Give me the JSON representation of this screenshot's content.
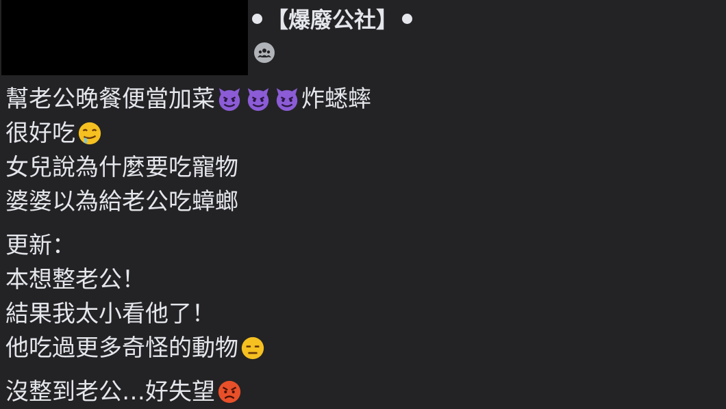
{
  "header": {
    "group_name": "【爆廢公社】",
    "audience_icon": "group-icon"
  },
  "post": {
    "paragraph1": [
      {
        "text": "幫老公晚餐便當加菜",
        "emojis": [
          "smiling-devil",
          "smiling-devil",
          "smiling-devil"
        ],
        "text_after": "炸蟋蟀"
      },
      {
        "text": "很好吃",
        "emojis": [
          "drooling-face"
        ]
      },
      {
        "text": "女兒說為什麼要吃寵物"
      },
      {
        "text": "婆婆以為給老公吃蟑螂"
      }
    ],
    "paragraph2": [
      {
        "text": "更新："
      },
      {
        "text": "本想整老公！"
      },
      {
        "text": "結果我太小看他了！"
      },
      {
        "text": "他吃過更多奇怪的動物",
        "emojis": [
          "expressionless-face"
        ]
      }
    ],
    "paragraph3": [
      {
        "text": "沒整到老公…好失望",
        "emojis": [
          "angry-face"
        ]
      }
    ]
  },
  "colors": {
    "background": "#232325",
    "text": "#e4e6eb",
    "devil_purple": "#8b5cd6",
    "emoji_yellow": "#f5c020",
    "angry_red": "#e8502a"
  }
}
